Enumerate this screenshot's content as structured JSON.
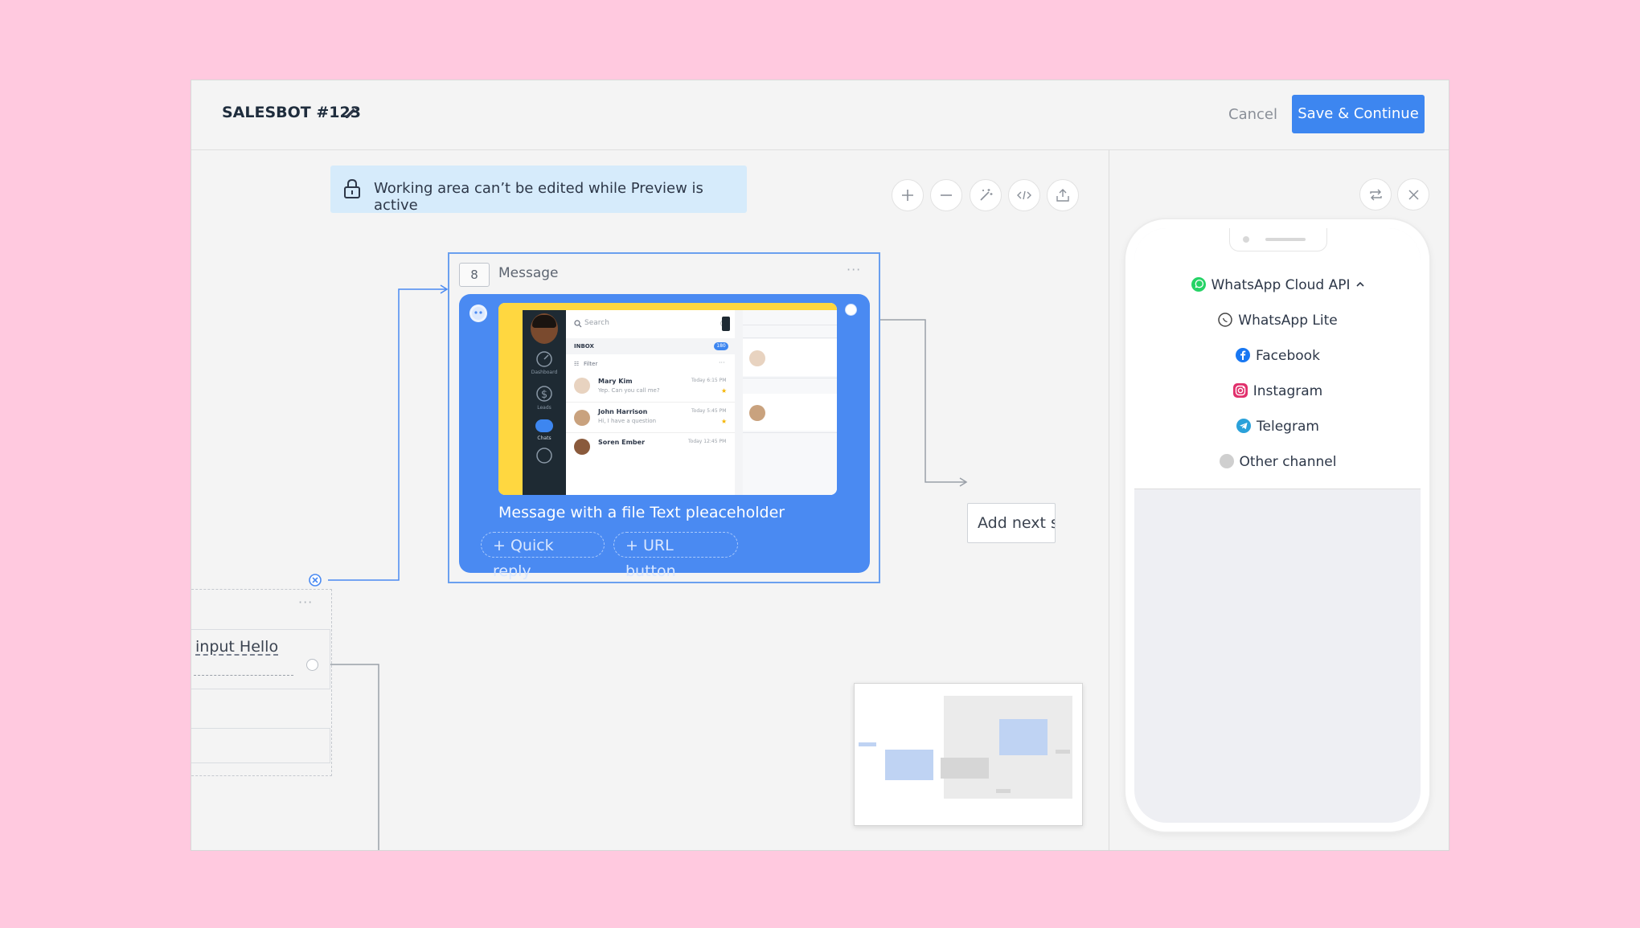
{
  "header": {
    "title": "SALESBOT #123",
    "cancel_label": "Cancel",
    "save_label": "Save & Continue"
  },
  "banner": {
    "text": "Working area can’t be edited while Preview is active"
  },
  "message_step": {
    "number": "8",
    "label": "Message",
    "text": "Message with a file Text pleaceholder",
    "quick_reply_label": "+ Quick reply",
    "url_button_label": "+ URL button",
    "preview": {
      "search_placeholder": "Search",
      "inbox_label": "INBOX",
      "inbox_count": "180",
      "filter_label": "Filter",
      "nav": [
        "Dashboard",
        "Leads",
        "Chats"
      ],
      "chats": [
        {
          "name": "Mary Kim",
          "snippet": "Yep. Can you call me?",
          "time": "Today 6:15 PM"
        },
        {
          "name": "John Harrison",
          "snippet": "Hi, I have a question",
          "time": "Today 5:45 PM"
        },
        {
          "name": "Soren Ember",
          "snippet": "",
          "time": "Today 12:45 PM"
        }
      ]
    }
  },
  "add_next_label": "Add next s",
  "input_node": {
    "text": "input Hello"
  },
  "channels": {
    "items": [
      {
        "label": "WhatsApp Cloud API",
        "icon": "whatsapp-icon",
        "color": "#25d366"
      },
      {
        "label": "WhatsApp Lite",
        "icon": "whatsapp-lite-icon",
        "color": "#444444"
      },
      {
        "label": "Facebook",
        "icon": "facebook-icon",
        "color": "#1877f2"
      },
      {
        "label": "Instagram",
        "icon": "instagram-icon",
        "color": "#e1306c"
      },
      {
        "label": "Telegram",
        "icon": "telegram-icon",
        "color": "#2aa1da"
      },
      {
        "label": "Other channel",
        "icon": "other-channel-icon",
        "color": "#cfcfcf"
      }
    ]
  },
  "colors": {
    "accent": "#3d86f0",
    "background": "#ffc9df",
    "message_bubble": "#4a8af2"
  }
}
